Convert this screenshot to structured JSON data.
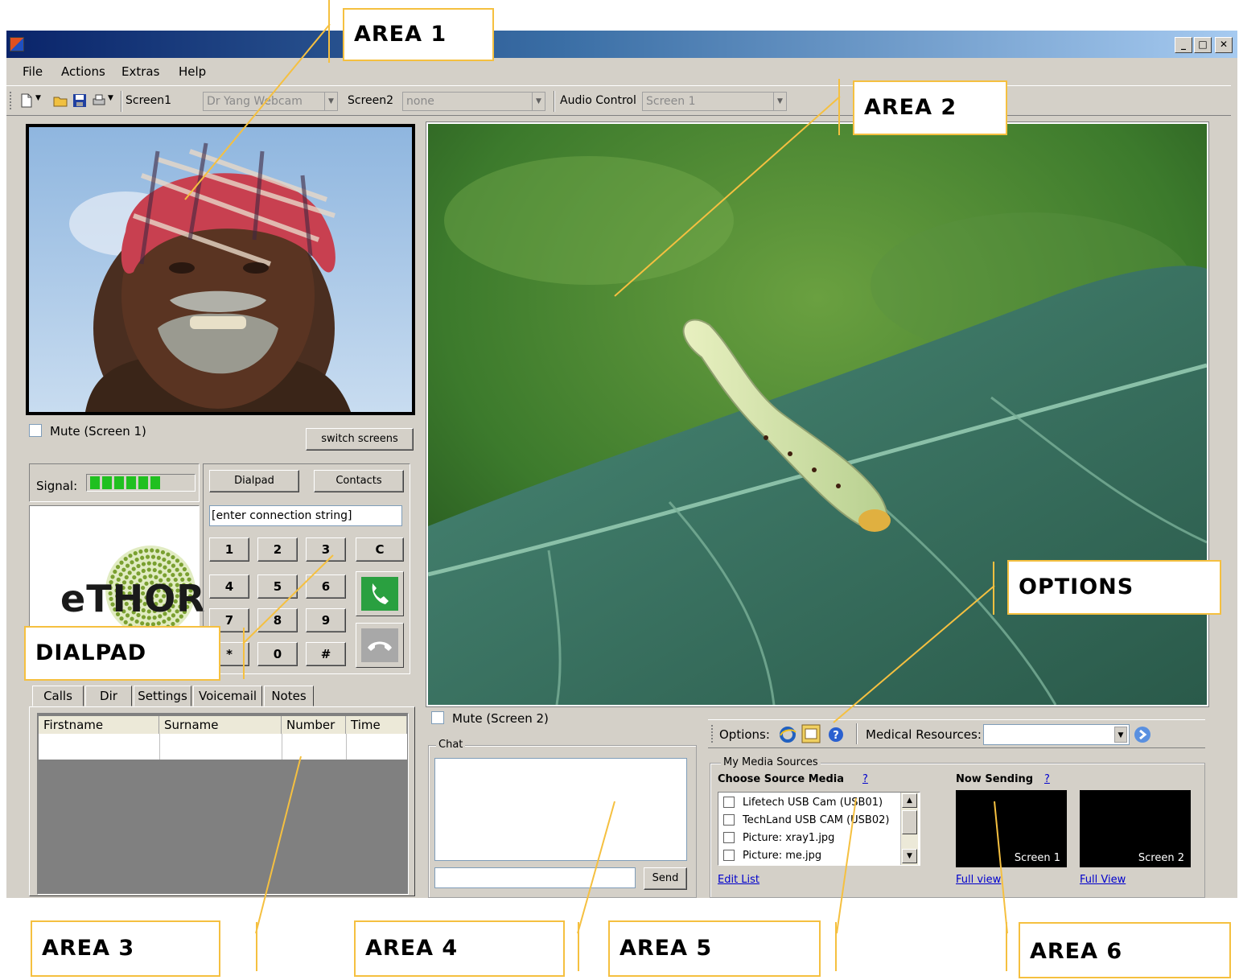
{
  "window": {
    "minimize": "_",
    "maximize": "□",
    "close": "✕"
  },
  "menu": [
    "File",
    "Actions",
    "Extras",
    "Help"
  ],
  "toolbar": {
    "screen1_label": "Screen1",
    "screen1_value": "Dr Yang Webcam",
    "screen2_label": "Screen2",
    "screen2_value": "none",
    "audio_label": "Audio Control",
    "audio_value": "Screen 1"
  },
  "screen1": {
    "mute_label": "Mute (Screen 1)",
    "switch_button": "switch screens"
  },
  "screen2": {
    "mute_label": "Mute (Screen 2)"
  },
  "signal": {
    "label": "Signal:",
    "bars_filled": 6
  },
  "logo": {
    "text": "eTHOR"
  },
  "dialpad": {
    "dialpad_button": "Dialpad",
    "contacts_button": "Contacts",
    "connection_value": "[enter connection string]",
    "keys": [
      "1",
      "2",
      "3",
      "4",
      "5",
      "6",
      "7",
      "8",
      "9",
      "*",
      "0",
      "#"
    ],
    "clear_key": "C"
  },
  "tabs": [
    "Calls",
    "Dir",
    "Settings",
    "Voicemail",
    "Notes"
  ],
  "calls_table": {
    "headers": [
      "Firstname",
      "Surname",
      "Number",
      "Time"
    ]
  },
  "chat": {
    "title": "Chat",
    "send_button": "Send"
  },
  "options": {
    "label": "Options:",
    "medical_label": "Medical Resources:",
    "medical_value": ""
  },
  "media": {
    "group_title": "My Media Sources",
    "choose_title": "Choose Source Media",
    "help": "?",
    "sources": [
      "Lifetech USB Cam (USB01)",
      "TechLand USB CAM (USB02)",
      "Picture: xray1.jpg",
      "Picture: me.jpg"
    ],
    "edit_list": "Edit List",
    "now_sending": "Now Sending",
    "screen1_label": "Screen 1",
    "screen2_label": "Screen 2",
    "full_view_1": "Full view",
    "full_view_2": "Full View"
  },
  "callouts": {
    "area1": "AREA 1",
    "area2": "AREA 2",
    "area3": "AREA 3",
    "area4": "AREA 4",
    "area5": "AREA 5",
    "area6": "AREA 6",
    "dialpad": "DIALPAD",
    "options": "OPTIONS"
  }
}
